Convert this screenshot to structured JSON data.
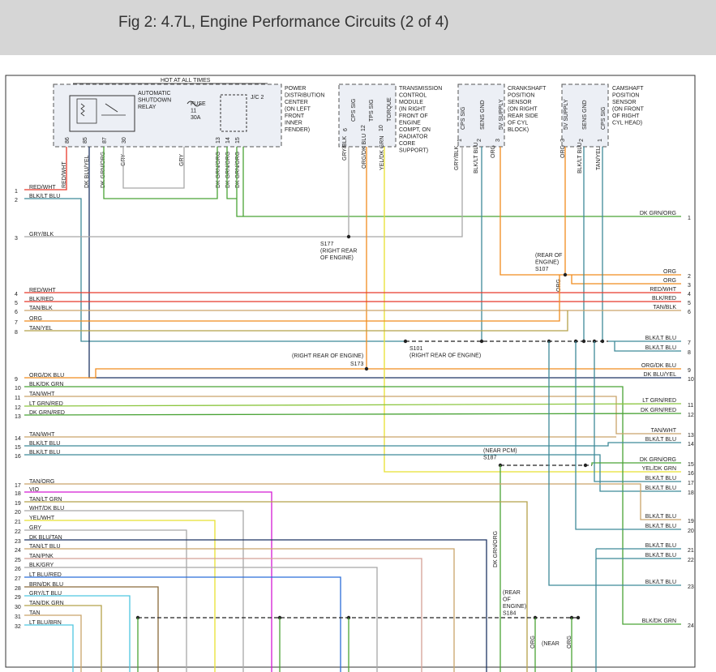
{
  "title": "Fig 2: 4.7L, Engine Performance Circuits (2 of 4)",
  "components": {
    "hot_at_all_times": "HOT AT ALL TIMES",
    "asd_relay": [
      "AUTOMATIC",
      "SHUTDOWN",
      "RELAY"
    ],
    "fuse": [
      "FUSE",
      "11",
      "30A"
    ],
    "jc2": "J/C 2",
    "pdc": [
      "POWER",
      "DISTRIBUTION",
      "CENTER",
      "(ON LEFT",
      "FRONT",
      "INNER",
      "FENDER)"
    ],
    "tcm": [
      "TRANSMISSION",
      "CONTROL",
      "MODULE",
      "(IN RIGHT",
      "FRONT OF",
      "ENGINE",
      "COMPT, ON",
      "RADIATOR",
      "CORE",
      "SUPPORT)"
    ],
    "ckp": [
      "CRANKSHAFT",
      "POSITION",
      "SENSOR",
      "(ON RIGHT",
      "REAR SIDE",
      "OF CYL",
      "BLOCK)"
    ],
    "cmp": [
      "CAMSHAFT",
      "POSITION",
      "SENSOR",
      "(ON FRONT",
      "OF RIGHT",
      "CYL HEAD)"
    ]
  },
  "pins": {
    "pdc": [
      "86",
      "85",
      "87",
      "30",
      "13",
      "14",
      "15"
    ],
    "tcm": [
      "6",
      "12",
      "10"
    ],
    "tcm_names": [
      "CPS SIG",
      "TPS SIG",
      "TORQUE"
    ],
    "ckp": [
      "1",
      "2",
      "3"
    ],
    "ckp_names": [
      "CPS SIG",
      "SENS GND",
      "5V SUPPLY"
    ],
    "cmp": [
      "3",
      "2",
      "1"
    ],
    "cmp_names": [
      "5V SUPPLY",
      "SENS GND",
      "CPS SIG"
    ]
  },
  "vertical_wire_labels": [
    "RED/WHT",
    "DK BLU/YEL",
    "DK GRN/ORG",
    "GRY",
    "GRY",
    "DK GRN/ORG",
    "DK GRN/ORG",
    "DK GRN/ORG",
    "GRY/BLK",
    "ORG/DK BLU",
    "YEL/DK GRN",
    "GRY/BLK",
    "BLK/LT BLU",
    "ORG",
    "ORG",
    "BLK/LT BLU",
    "TAN/YEL",
    "ORG",
    "DK GRN/ORG",
    "ORG",
    "ORG"
  ],
  "splices": {
    "s177": [
      "S177",
      "(RIGHT REAR",
      "OF ENGINE)"
    ],
    "s107": [
      "(REAR OF",
      "ENGINE)",
      "S107"
    ],
    "s101": [
      "S101",
      "(RIGHT REAR OF ENGINE)"
    ],
    "s173": [
      "(RIGHT REAR OF ENGINE)",
      "S173"
    ],
    "s187": [
      "(NEAR PCM)",
      "S187"
    ],
    "s184": [
      "(REAR",
      "OF",
      "ENGINE)",
      "S184"
    ],
    "near": "(NEAR"
  },
  "left_circuits": [
    {
      "n": "1",
      "label": "RED/WHT"
    },
    {
      "n": "2",
      "label": "BLK/LT BLU"
    },
    {
      "n": "3",
      "label": "GRY/BLK"
    },
    {
      "n": "4",
      "label": "RED/WHT"
    },
    {
      "n": "5",
      "label": "BLK/RED"
    },
    {
      "n": "6",
      "label": "TAN/BLK"
    },
    {
      "n": "7",
      "label": "ORG"
    },
    {
      "n": "8",
      "label": "TAN/YEL"
    },
    {
      "n": "9",
      "label": "ORG/DK BLU"
    },
    {
      "n": "10",
      "label": "BLK/DK GRN"
    },
    {
      "n": "11",
      "label": "TAN/WHT"
    },
    {
      "n": "12",
      "label": "LT GRN/RED"
    },
    {
      "n": "13",
      "label": "DK GRN/RED"
    },
    {
      "n": "14",
      "label": "TAN/WHT"
    },
    {
      "n": "15",
      "label": "BLK/LT BLU"
    },
    {
      "n": "16",
      "label": "BLK/LT BLU"
    },
    {
      "n": "17",
      "label": "TAN/ORG"
    },
    {
      "n": "18",
      "label": "VIO"
    },
    {
      "n": "19",
      "label": "TAN/LT GRN"
    },
    {
      "n": "20",
      "label": "WHT/DK BLU"
    },
    {
      "n": "21",
      "label": "YEL/WHT"
    },
    {
      "n": "22",
      "label": "GRY"
    },
    {
      "n": "23",
      "label": "DK BLU/TAN"
    },
    {
      "n": "24",
      "label": "TAN/LT BLU"
    },
    {
      "n": "25",
      "label": "TAN/PNK"
    },
    {
      "n": "26",
      "label": "BLK/GRY"
    },
    {
      "n": "27",
      "label": "LT BLU/RED"
    },
    {
      "n": "28",
      "label": "BRN/DK BLU"
    },
    {
      "n": "29",
      "label": "GRY/LT BLU"
    },
    {
      "n": "30",
      "label": "TAN/DK GRN"
    },
    {
      "n": "31",
      "label": "TAN"
    },
    {
      "n": "32",
      "label": "LT BLU/BRN"
    }
  ],
  "right_circuits": [
    {
      "n": "1",
      "label": "DK GRN/ORG"
    },
    {
      "n": "2",
      "label": "ORG"
    },
    {
      "n": "3",
      "label": "ORG"
    },
    {
      "n": "4",
      "label": "RED/WHT"
    },
    {
      "n": "5",
      "label": "BLK/RED"
    },
    {
      "n": "6",
      "label": "TAN/BLK"
    },
    {
      "n": "7",
      "label": "BLK/LT BLU"
    },
    {
      "n": "8",
      "label": "BLK/LT BLU"
    },
    {
      "n": "9",
      "label": "ORG/DK BLU"
    },
    {
      "n": "10",
      "label": "DK BLU/YEL"
    },
    {
      "n": "11",
      "label": "LT GRN/RED"
    },
    {
      "n": "12",
      "label": "DK GRN/RED"
    },
    {
      "n": "13",
      "label": "TAN/WHT"
    },
    {
      "n": "14",
      "label": "BLK/LT BLU"
    },
    {
      "n": "15",
      "label": "DK GRN/ORG"
    },
    {
      "n": "16",
      "label": "YEL/DK GRN"
    },
    {
      "n": "17",
      "label": "BLK/LT BLU"
    },
    {
      "n": "18",
      "label": "BLK/LT BLU"
    },
    {
      "n": "19",
      "label": "BLK/LT BLU"
    },
    {
      "n": "20",
      "label": "BLK/LT BLU"
    },
    {
      "n": "21",
      "label": "BLK/LT BLU"
    },
    {
      "n": "22",
      "label": "BLK/LT BLU"
    },
    {
      "n": "23",
      "label": "BLK/LT BLU"
    },
    {
      "n": "24",
      "label": "BLK/DK GRN"
    }
  ],
  "colors": {
    "red": "#e8392b",
    "blue": "#2b6dd9",
    "teal": "#3f8a99",
    "green": "#4aa336",
    "gray": "#a8a8a8",
    "orange": "#f08c1e",
    "yellow": "#e8e030",
    "tan": "#c9a46a",
    "olive": "#b5a24a",
    "violet": "#d41ad4",
    "navy": "#1f3563",
    "pink": "#d4a096",
    "lightblue": "#4fc7e0",
    "brown": "#8a6a3a",
    "ltgreen": "#8cc640",
    "black": "#222"
  }
}
